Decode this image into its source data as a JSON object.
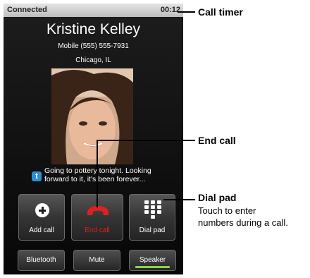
{
  "status_bar": {
    "state": "Connected",
    "timer": "00:12"
  },
  "caller": {
    "name": "Kristine Kelley",
    "number": "Mobile (555) 555-7931",
    "location": "Chicago, IL"
  },
  "social_update": {
    "icon": "twitter-icon",
    "text_line1": "Going to pottery tonight. Looking",
    "text_line2": "forward to it, it's been forever..."
  },
  "buttons": {
    "add_call": "Add call",
    "end_call": "End call",
    "dial_pad": "Dial pad",
    "bluetooth": "Bluetooth",
    "mute": "Mute",
    "speaker": "Speaker"
  },
  "callouts": {
    "call_timer": "Call timer",
    "end_call": "End call",
    "dial_pad_title": "Dial pad",
    "dial_pad_desc_line1": "Touch to enter",
    "dial_pad_desc_line2": "numbers during a call."
  },
  "colors": {
    "end_call_red": "#e02020",
    "speaker_active": "#8cd24a",
    "twitter_blue": "#2a8fd8"
  }
}
